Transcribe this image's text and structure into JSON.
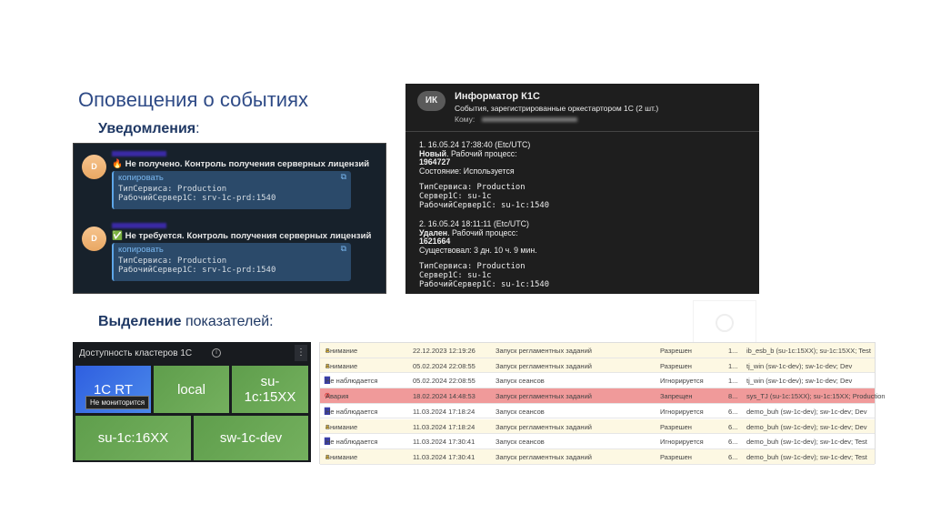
{
  "title": "Оповещения о событиях",
  "notifications": {
    "label": "Уведомления",
    "colon": ":"
  },
  "highlight": {
    "label_bold": "Выделение",
    "label_rest": " показателей:"
  },
  "telegram": {
    "messages": [
      {
        "avatar": "D",
        "emoji": "🔥",
        "text": "Не получено. Контроль получения серверных лицензий",
        "copy": "копировать",
        "line1": "ТипСервиса: Production",
        "line2": "РабочийСервер1С: srv-1c-prd:1540"
      },
      {
        "avatar": "D",
        "emoji": "✅",
        "text": "Не требуется. Контроль получения серверных лицензий",
        "copy": "копировать",
        "line1": "ТипСервиса: Production",
        "line2": "РабочийСервер1С: srv-1c-prd:1540"
      }
    ]
  },
  "mail": {
    "avatar": "ИК",
    "from": "Информатор К1С",
    "subject": "События, зарегистрированные оркестартором 1С (2 шт.)",
    "to_label": "Кому:",
    "events": [
      {
        "header": "1. 16.05.24 17:38:40 (Etc/UTC)",
        "status": "Новый",
        "status_rest": ". Рабочий процесс:",
        "pid": "1964727",
        "extra": "Состояние: Используется",
        "service": "ТипСервиса: Production",
        "server": "Сервер1С: su-1c",
        "worker": "РабочийСервер1С: su-1c:1540"
      },
      {
        "header": "2. 16.05.24 18:11:11 (Etc/UTC)",
        "status": "Удален",
        "status_rest": ". Рабочий процесс:",
        "pid": "1621664",
        "extra": "Существовал: 3 дн. 10 ч. 9 мин.",
        "service": "ТипСервиса: Production",
        "server": "Сервер1С: su-1c",
        "worker": "РабочийСервер1С: su-1c:1540"
      }
    ]
  },
  "dashboard": {
    "title": "Доступность кластеров 1С",
    "tiles": [
      "1C RT",
      "local",
      "su-1c:15XX",
      "su-1c:16XX",
      "sw-1c-dev"
    ],
    "tooltip": "Не мониторится"
  },
  "table": {
    "rows": [
      {
        "type": "warn",
        "status": "Внимание",
        "date": "22.12.2023 12:19:26",
        "event": "Запуск регламентных заданий",
        "state": "Разрешен",
        "num": "1...",
        "desc": "ib_esb_b (su-1c:15XX); su-1c:15XX; Test"
      },
      {
        "type": "warn",
        "status": "Внимание",
        "date": "05.02.2024 22:08:55",
        "event": "Запуск регламентных заданий",
        "state": "Разрешен",
        "num": "1...",
        "desc": "tj_win (sw-1c-dev); sw-1c-dev; Dev"
      },
      {
        "type": "none",
        "status": "Не наблюдается",
        "date": "05.02.2024 22:08:55",
        "event": "Запуск сеансов",
        "state": "Игнорируется",
        "num": "1...",
        "desc": "tj_win (sw-1c-dev); sw-1c-dev; Dev"
      },
      {
        "type": "alarm",
        "status": "Авария",
        "date": "18.02.2024 14:48:53",
        "event": "Запуск регламентных заданий",
        "state": "Запрещен",
        "num": "8...",
        "desc": "sys_TJ (su-1c:15XX); su-1c:15XX; Production"
      },
      {
        "type": "none",
        "status": "Не наблюдается",
        "date": "11.03.2024 17:18:24",
        "event": "Запуск сеансов",
        "state": "Игнорируется",
        "num": "6...",
        "desc": "demo_buh (sw-1c-dev); sw-1c-dev; Dev"
      },
      {
        "type": "warn",
        "status": "Внимание",
        "date": "11.03.2024 17:18:24",
        "event": "Запуск регламентных заданий",
        "state": "Разрешен",
        "num": "6...",
        "desc": "demo_buh (sw-1c-dev); sw-1c-dev; Dev"
      },
      {
        "type": "none",
        "status": "Не наблюдается",
        "date": "11.03.2024 17:30:41",
        "event": "Запуск сеансов",
        "state": "Игнорируется",
        "num": "6...",
        "desc": "demo_buh (sw-1c-dev); sw-1c-dev; Test"
      },
      {
        "type": "warn",
        "status": "Внимание",
        "date": "11.03.2024 17:30:41",
        "event": "Запуск регламентных заданий",
        "state": "Разрешен",
        "num": "6...",
        "desc": "demo_buh (sw-1c-dev); sw-1c-dev; Test"
      }
    ]
  },
  "colors": {
    "warn_row": "#fdf8e3",
    "alarm_row": "#f09a9a",
    "tile_green": "#6aa854",
    "tile_blue": "#3a6fe0"
  }
}
